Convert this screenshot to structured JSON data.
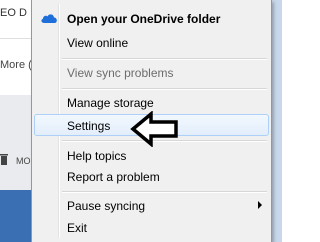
{
  "background": {
    "fragments": [
      "EO D",
      "More (",
      "MO"
    ]
  },
  "menu": {
    "items": [
      {
        "label": "Open your OneDrive folder",
        "icon": "onedrive-cloud-icon"
      },
      {
        "label": "View online"
      },
      {
        "label": "View sync problems",
        "disabled": true
      },
      {
        "label": "Manage storage"
      },
      {
        "label": "Settings",
        "highlighted": true
      },
      {
        "label": "Help topics"
      },
      {
        "label": "Report a problem"
      },
      {
        "label": "Pause syncing",
        "submenu": true
      },
      {
        "label": "Exit"
      }
    ]
  },
  "annotation": {
    "icon": "outline-arrow-left-icon"
  },
  "colors": {
    "accent": "#1e6fd9",
    "hover_border": "#aecff7"
  }
}
